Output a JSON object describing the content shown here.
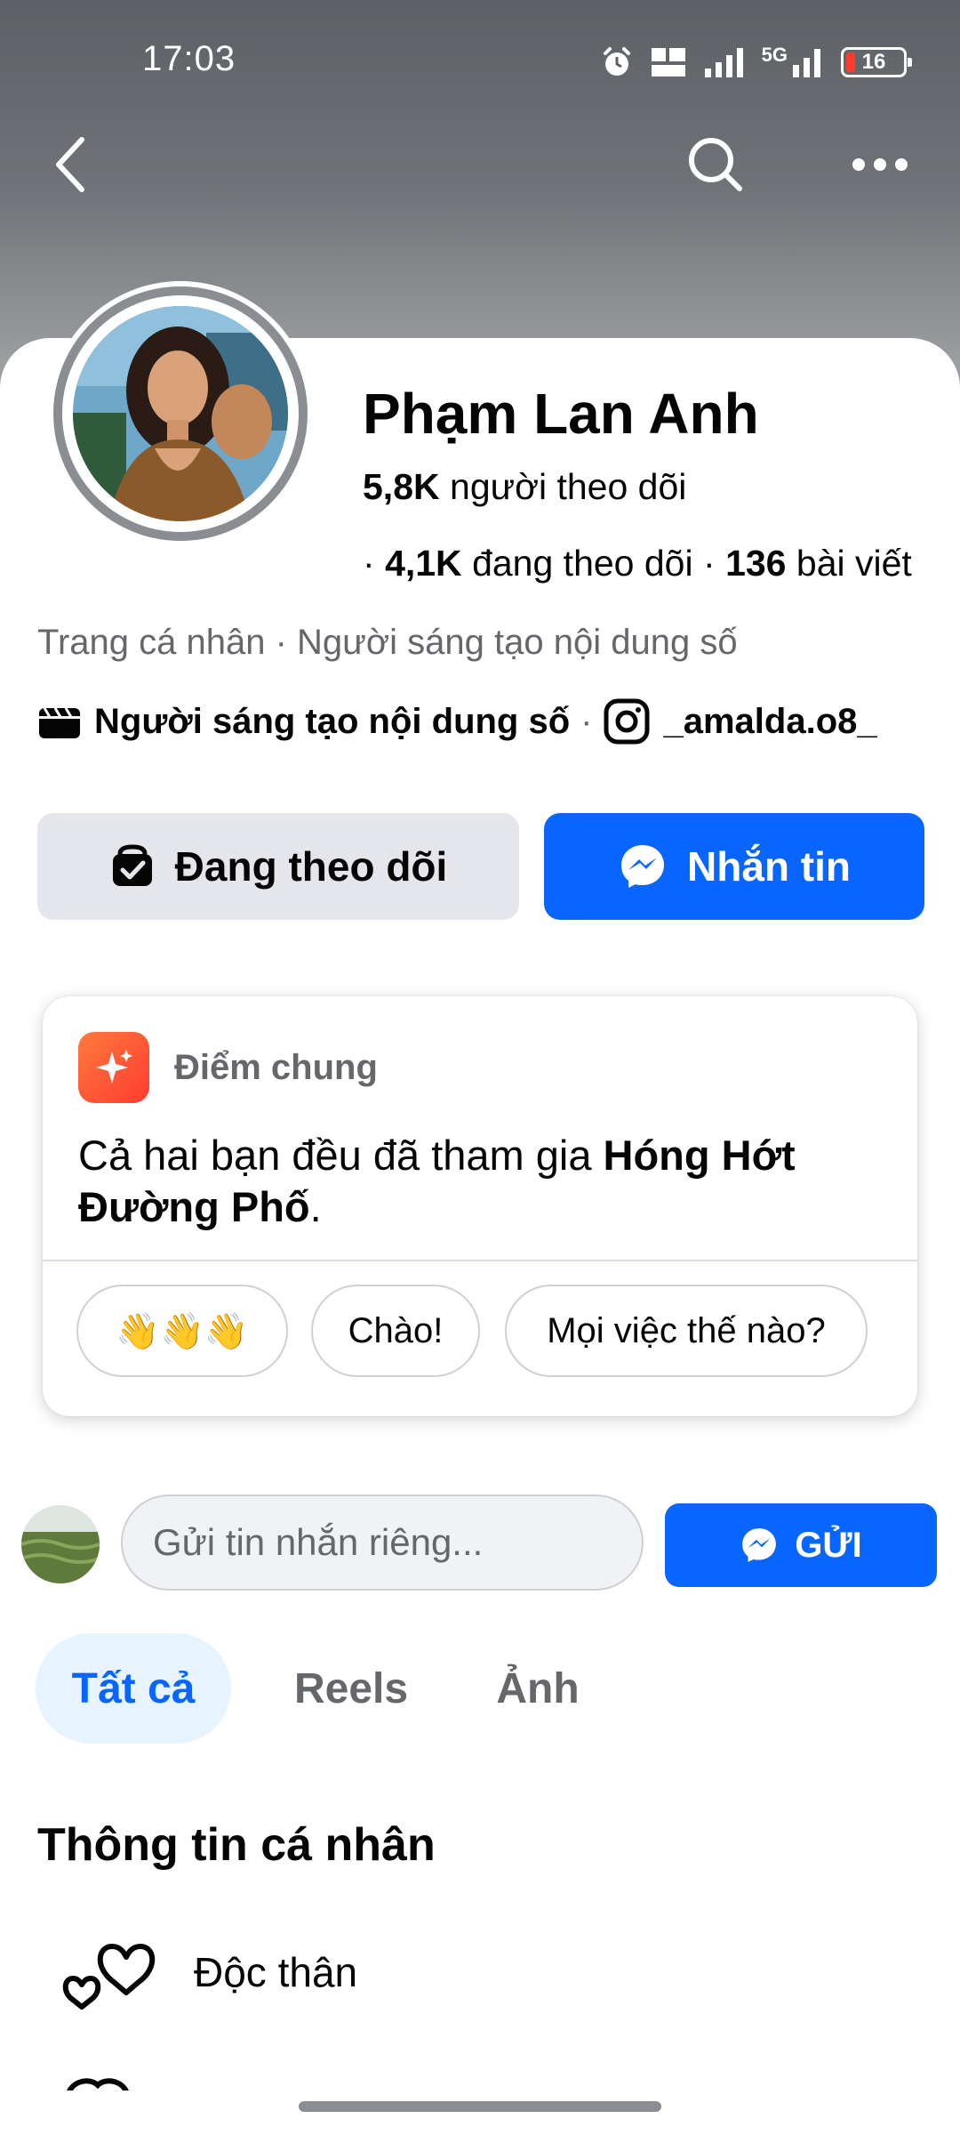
{
  "status_bar": {
    "time": "17:03",
    "network_label": "5G",
    "battery_level": "16",
    "icons": [
      "alarm-icon",
      "volte-icon",
      "signal-icon",
      "5g-signal-icon",
      "battery-icon"
    ]
  },
  "nav": {
    "icons": [
      "back-arrow-icon",
      "search-icon",
      "more-icon"
    ]
  },
  "profile": {
    "name": "Phạm Lan Anh",
    "followers_count": "5,8K",
    "followers_label": "người theo dõi",
    "following_count": "4,1K",
    "following_label": "đang theo dõi",
    "posts_count": "136",
    "posts_label": "bài viết",
    "bullet": "·",
    "category_line": "Trang cá nhân · Người sáng tạo nội dung số",
    "creator_label": "Người sáng tạo nội dung số",
    "separator": "·",
    "instagram_handle": "_amalda.o8_"
  },
  "actions": {
    "following_label": "Đang theo dõi",
    "message_label": "Nhắn tin"
  },
  "common": {
    "title": "Điểm chung",
    "text_prefix": "Cả hai bạn đều đã tham gia ",
    "group_name": "Hóng Hớt Đường Phố",
    "text_suffix": ".",
    "chips": [
      "👋👋👋",
      "Chào!",
      "Mọi việc thế nào?"
    ]
  },
  "message_box": {
    "placeholder": "Gửi tin nhắn riêng...",
    "send_label": "GỬI"
  },
  "tabs": [
    "Tất cả",
    "Reels",
    "Ảnh"
  ],
  "about": {
    "title": "Thông tin cá nhân",
    "relationship": "Độc thân"
  },
  "colors": {
    "accent": "#0866ff",
    "tab_active_bg": "#e7f3ff",
    "secondary_text": "#65676b",
    "button_gray": "#e4e6eb"
  }
}
